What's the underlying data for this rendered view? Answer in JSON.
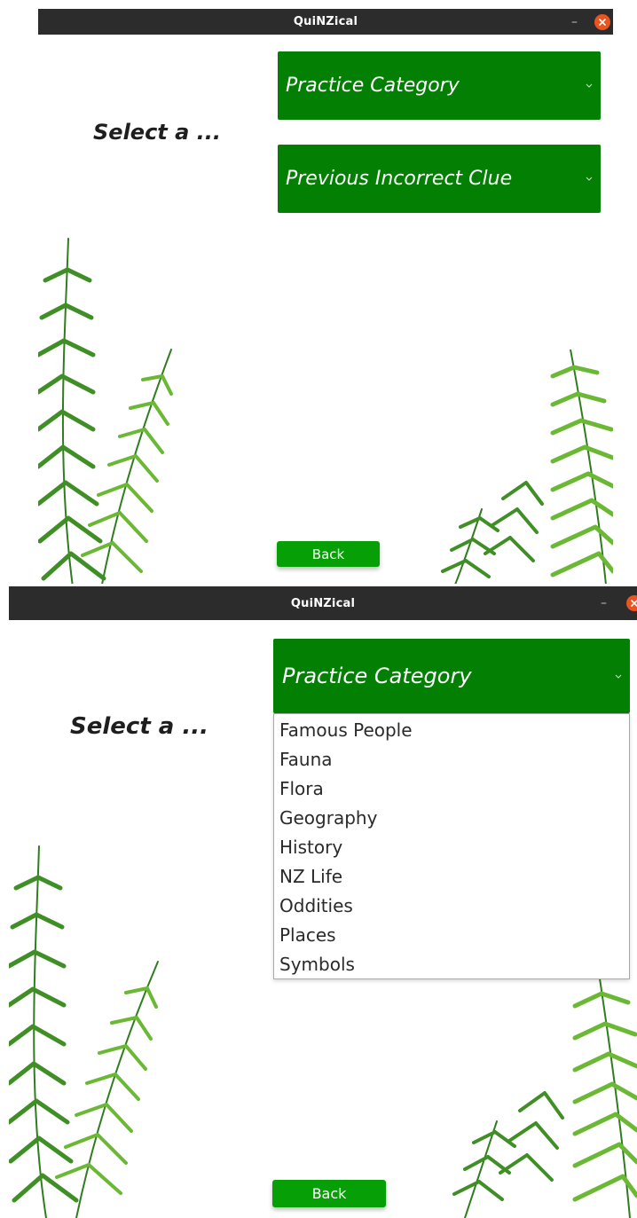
{
  "screens": [
    {
      "window": {
        "title": "QuiNZical"
      },
      "prompt": "Select a ...",
      "combos": [
        {
          "label": "Practice Category"
        },
        {
          "label": "Previous Incorrect Clue"
        }
      ],
      "back_label": "Back"
    },
    {
      "window": {
        "title": "QuiNZical"
      },
      "prompt": "Select a ...",
      "combos": [
        {
          "label": "Practice Category"
        }
      ],
      "dropdown_options": [
        "Famous People",
        "Fauna",
        "Flora",
        "Geography",
        "History",
        "NZ Life",
        "Oddities",
        "Places",
        "Symbols"
      ],
      "back_label": "Back"
    }
  ],
  "colors": {
    "titlebar": "#2c2c2c",
    "close_button": "#e95420",
    "combo_green": "#038003",
    "button_green": "#06a006",
    "fern_dark": "#2f7d1e",
    "fern_light": "#6ab834"
  },
  "icons": {
    "window_minimize": "minimize-icon",
    "window_close": "close-icon",
    "combo_arrow": "chevron-down-icon"
  }
}
